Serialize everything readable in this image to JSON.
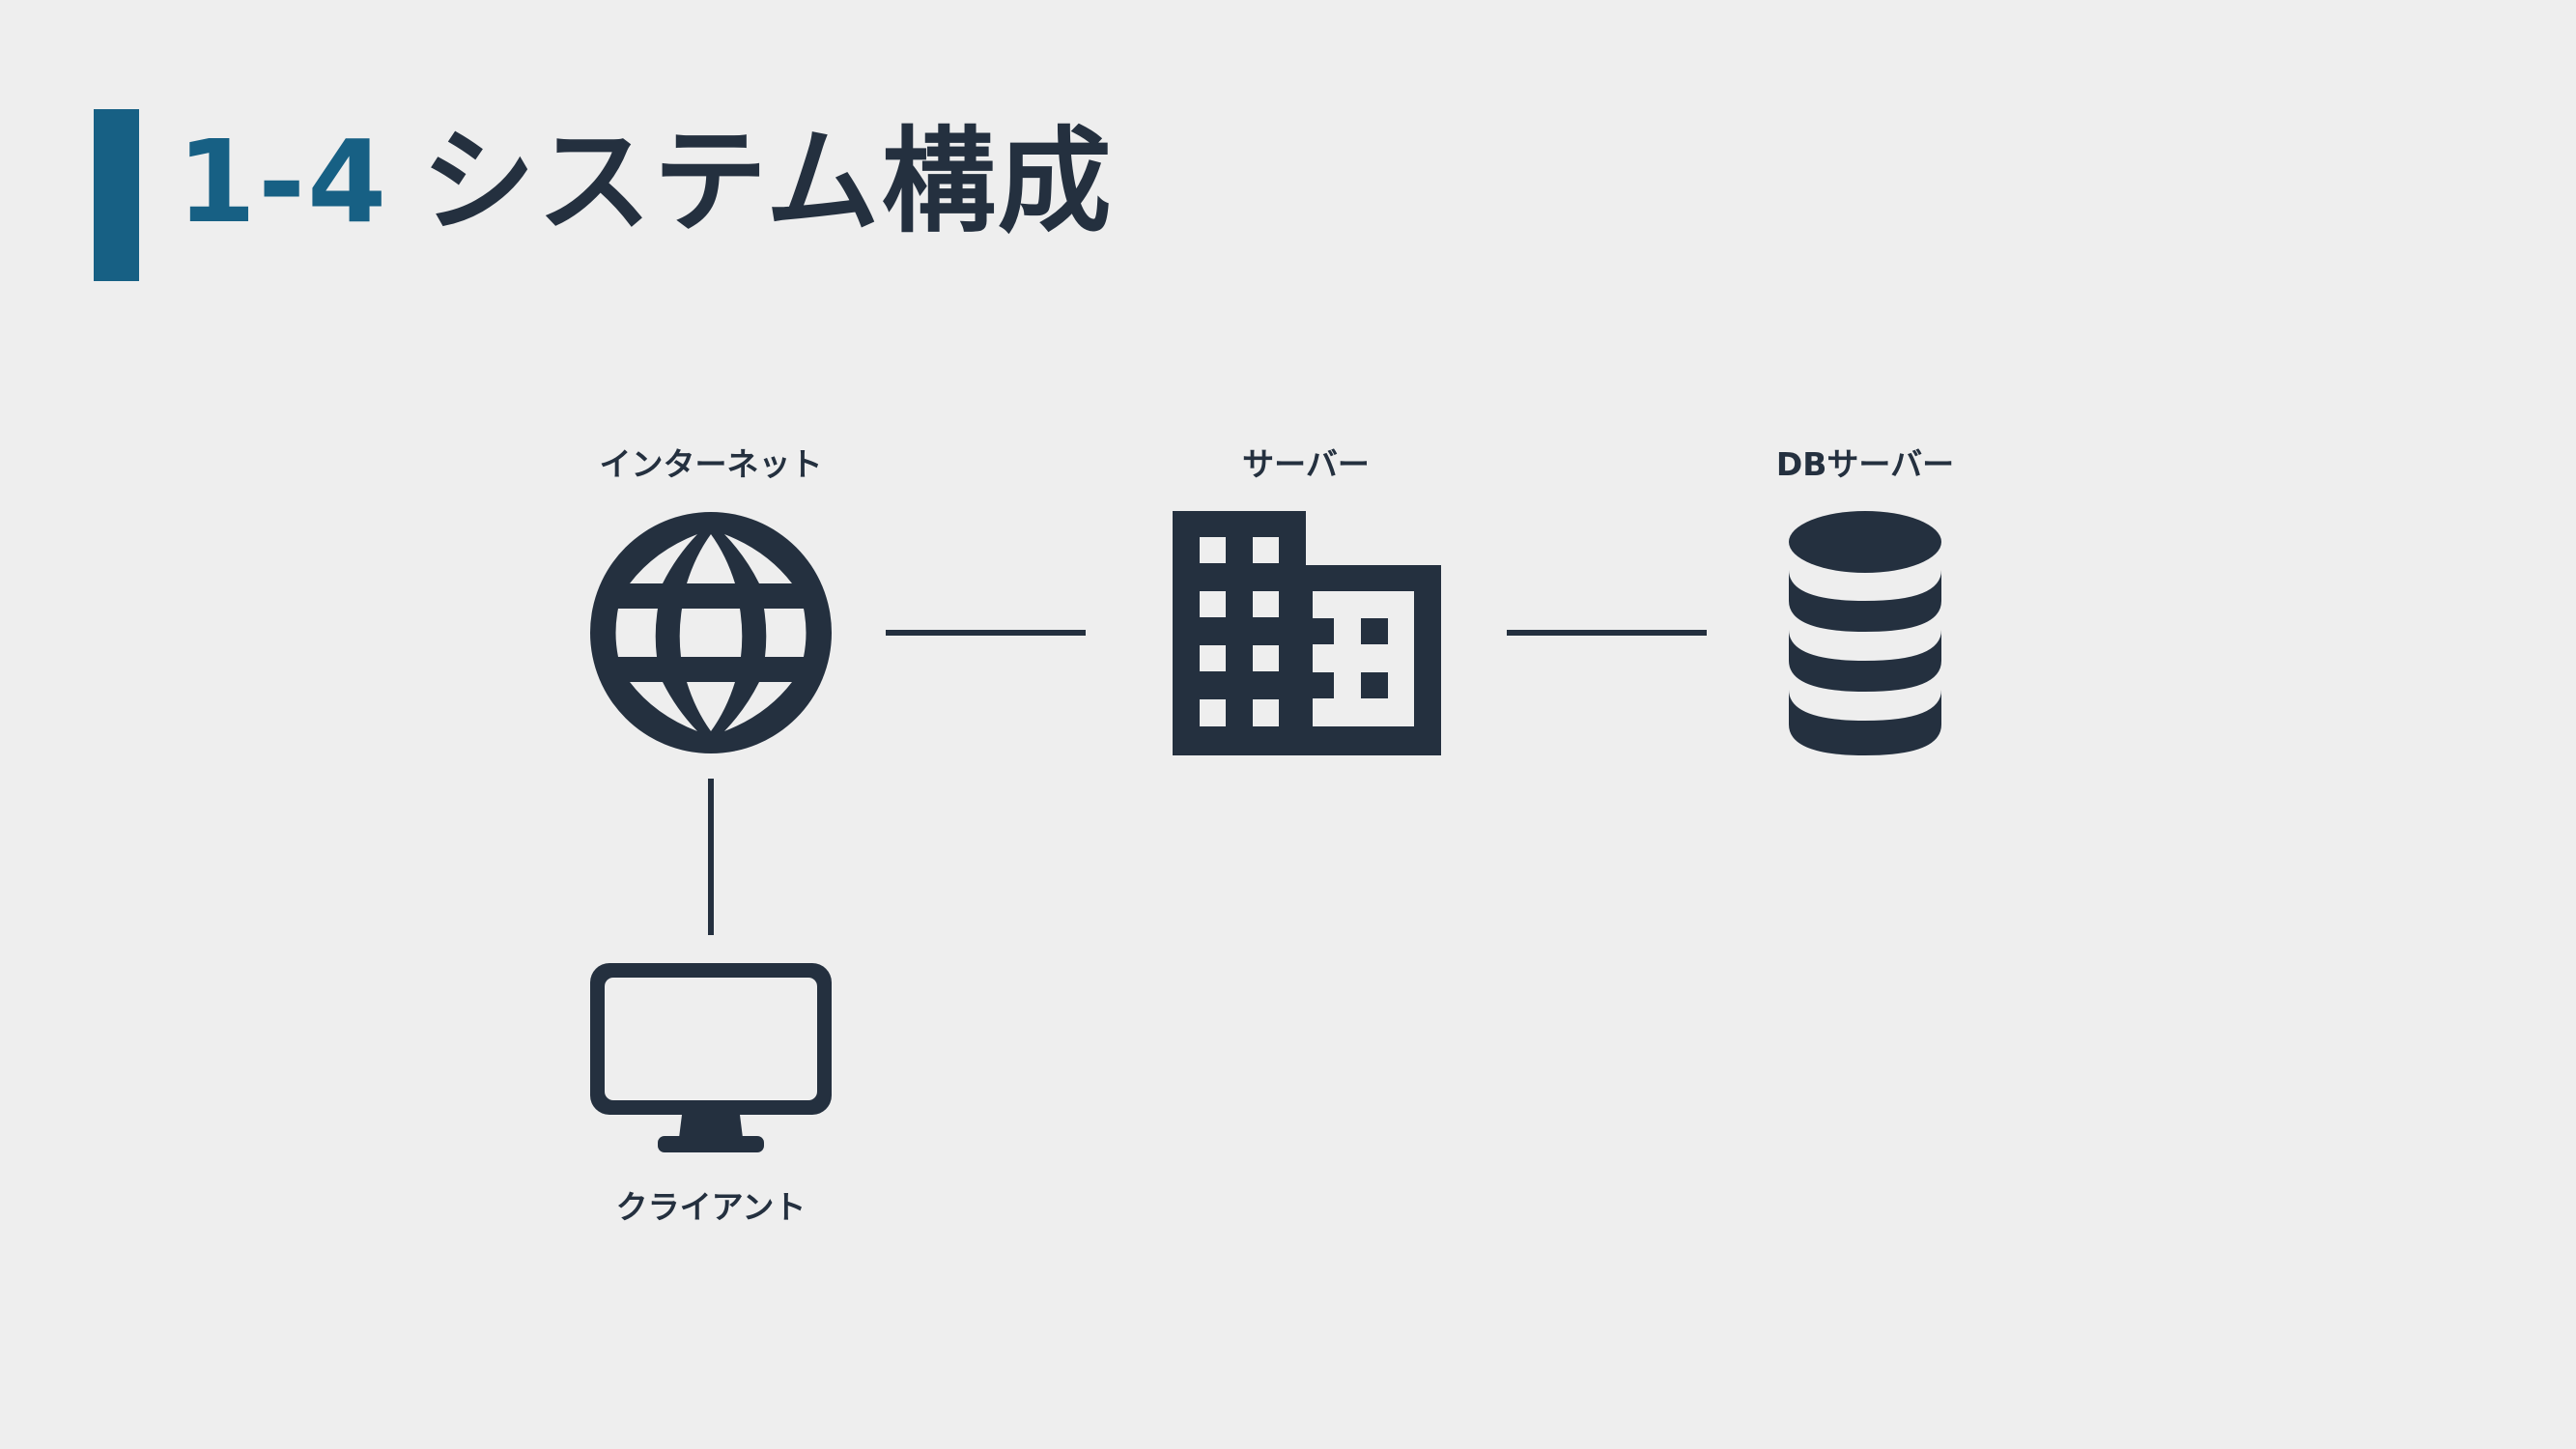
{
  "title": {
    "number": "1-4",
    "text": "システム構成"
  },
  "nodes": {
    "internet": {
      "label": "インターネット",
      "icon": "globe-icon"
    },
    "server": {
      "label": "サーバー",
      "icon": "building-icon"
    },
    "db_server": {
      "label": "DBサーバー",
      "icon": "database-icon"
    },
    "client": {
      "label": "クライアント",
      "icon": "monitor-icon"
    }
  },
  "connections": [
    [
      "internet",
      "server"
    ],
    [
      "server",
      "db_server"
    ],
    [
      "internet",
      "client"
    ]
  ],
  "colors": {
    "background": "#eeeeee",
    "accent": "#176084",
    "foreground": "#24303f"
  }
}
